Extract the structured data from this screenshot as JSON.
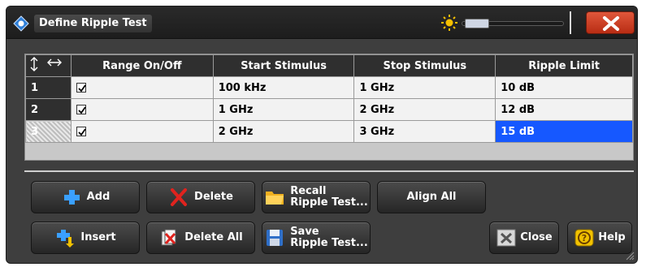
{
  "window": {
    "title": "Define Ripple Test"
  },
  "grid": {
    "columns": [
      "Range On/Off",
      "Start Stimulus",
      "Stop Stimulus",
      "Ripple Limit"
    ],
    "rows": [
      {
        "index": "1",
        "on": true,
        "start": "100 kHz",
        "stop": "1 GHz",
        "limit": "10 dB"
      },
      {
        "index": "2",
        "on": true,
        "start": "1 GHz",
        "stop": "2 GHz",
        "limit": "12 dB"
      },
      {
        "index": "3",
        "on": true,
        "start": "2 GHz",
        "stop": "3 GHz",
        "limit": "15 dB"
      }
    ],
    "selected_row": 3,
    "active_cell": "Ripple Limit"
  },
  "buttons": {
    "add": "Add",
    "delete": "Delete",
    "recall_line1": "Recall",
    "recall_line2": "Ripple Test...",
    "align_all": "Align All",
    "insert": "Insert",
    "delete_all": "Delete All",
    "save_line1": "Save",
    "save_line2": "Ripple Test...",
    "close": "Close",
    "help": "Help"
  },
  "colors": {
    "accent": "#1658ff",
    "close_red": "#c83a20",
    "add_icon": "#3aa0ff",
    "delete_icon": "#e0231e"
  }
}
